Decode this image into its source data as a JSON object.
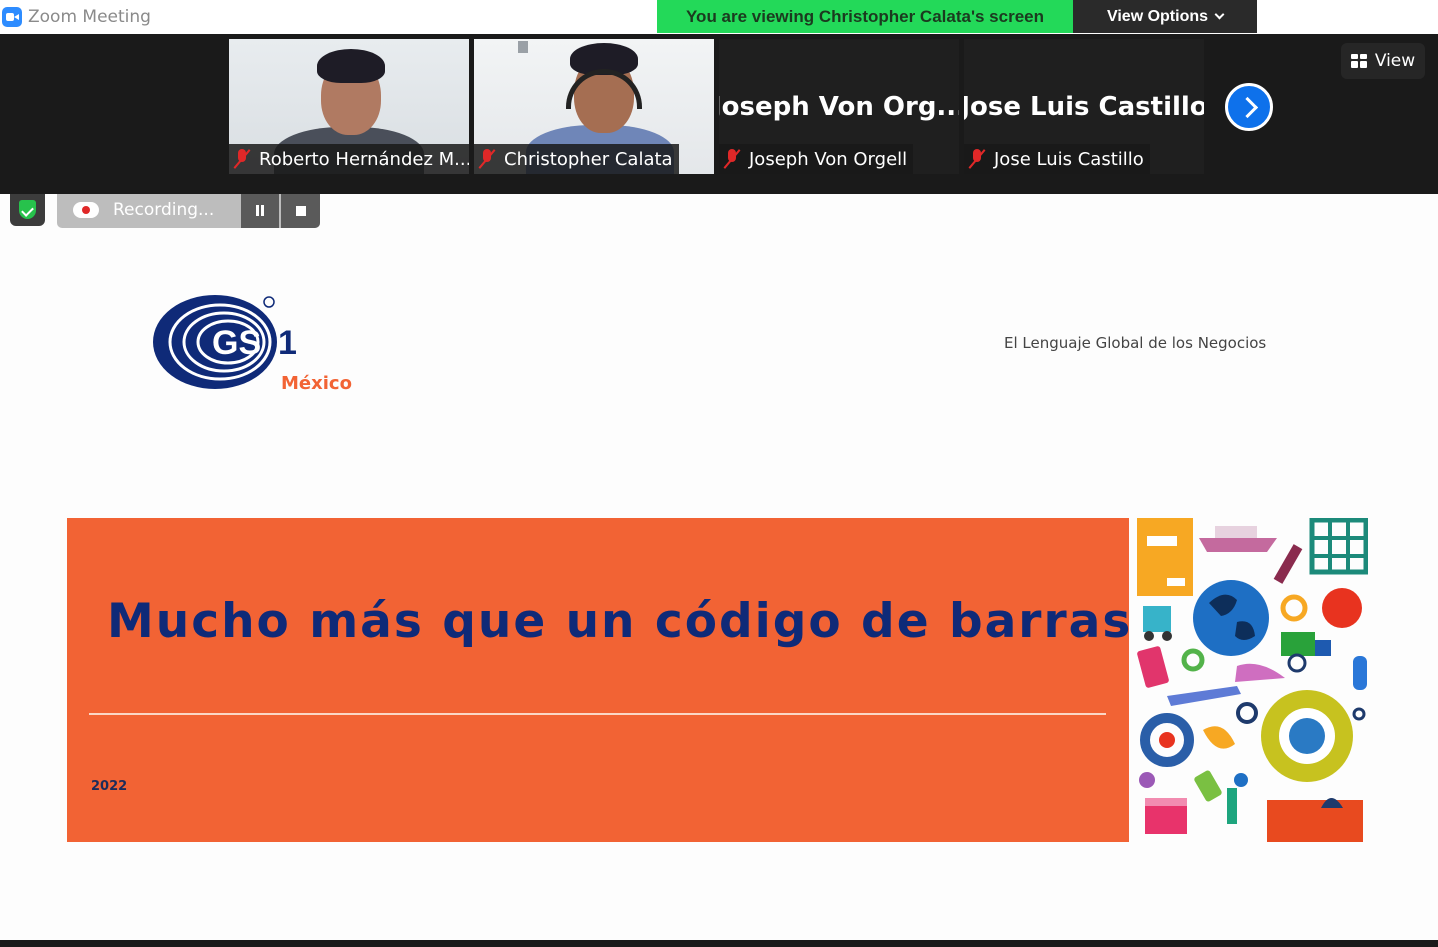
{
  "window": {
    "title": "Zoom Meeting",
    "app_icon": "zoom-camera-icon"
  },
  "banner": {
    "viewing_text": "You are viewing Christopher Calata's screen",
    "view_options_label": "View Options"
  },
  "participants": [
    {
      "name_label": "Roberto Hernández M...",
      "muted": true,
      "video": true
    },
    {
      "name_label": "Christopher Calata",
      "muted": true,
      "video": true
    },
    {
      "display_name": "Joseph  Von  Org...",
      "name_label": "Joseph Von Orgell",
      "muted": true,
      "video": false
    },
    {
      "display_name": "Jose Luis Castillo",
      "name_label": "Jose Luis Castillo",
      "muted": true,
      "video": false
    }
  ],
  "strip_controls": {
    "view_label": "View",
    "next_icon": "chevron-right-icon"
  },
  "recording": {
    "label": "Recording...",
    "pause_icon": "pause-icon",
    "stop_icon": "stop-icon"
  },
  "slide": {
    "logo_text": "GS1",
    "logo_subtitle": "México",
    "tagline": "El Lenguaje Global de los Negocios",
    "title": "Mucho más que un código de barras",
    "year": "2022"
  },
  "colors": {
    "banner_green": "#23d959",
    "slide_orange": "#f26334",
    "title_navy": "#0f2a78",
    "zoom_blue": "#0e71eb",
    "mic_red": "#e02828"
  }
}
